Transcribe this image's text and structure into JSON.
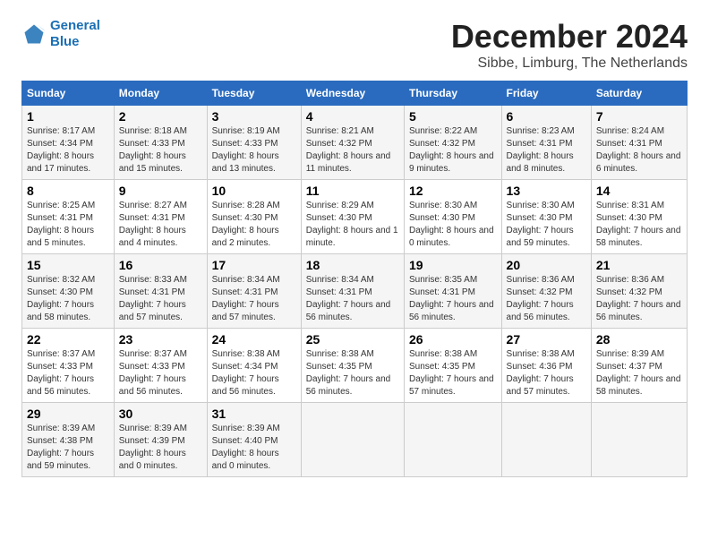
{
  "logo": {
    "line1": "General",
    "line2": "Blue"
  },
  "title": "December 2024",
  "subtitle": "Sibbe, Limburg, The Netherlands",
  "weekdays": [
    "Sunday",
    "Monday",
    "Tuesday",
    "Wednesday",
    "Thursday",
    "Friday",
    "Saturday"
  ],
  "weeks": [
    [
      {
        "day": "1",
        "sunrise": "8:17 AM",
        "sunset": "4:34 PM",
        "daylight": "8 hours and 17 minutes."
      },
      {
        "day": "2",
        "sunrise": "8:18 AM",
        "sunset": "4:33 PM",
        "daylight": "8 hours and 15 minutes."
      },
      {
        "day": "3",
        "sunrise": "8:19 AM",
        "sunset": "4:33 PM",
        "daylight": "8 hours and 13 minutes."
      },
      {
        "day": "4",
        "sunrise": "8:21 AM",
        "sunset": "4:32 PM",
        "daylight": "8 hours and 11 minutes."
      },
      {
        "day": "5",
        "sunrise": "8:22 AM",
        "sunset": "4:32 PM",
        "daylight": "8 hours and 9 minutes."
      },
      {
        "day": "6",
        "sunrise": "8:23 AM",
        "sunset": "4:31 PM",
        "daylight": "8 hours and 8 minutes."
      },
      {
        "day": "7",
        "sunrise": "8:24 AM",
        "sunset": "4:31 PM",
        "daylight": "8 hours and 6 minutes."
      }
    ],
    [
      {
        "day": "8",
        "sunrise": "8:25 AM",
        "sunset": "4:31 PM",
        "daylight": "8 hours and 5 minutes."
      },
      {
        "day": "9",
        "sunrise": "8:27 AM",
        "sunset": "4:31 PM",
        "daylight": "8 hours and 4 minutes."
      },
      {
        "day": "10",
        "sunrise": "8:28 AM",
        "sunset": "4:30 PM",
        "daylight": "8 hours and 2 minutes."
      },
      {
        "day": "11",
        "sunrise": "8:29 AM",
        "sunset": "4:30 PM",
        "daylight": "8 hours and 1 minute."
      },
      {
        "day": "12",
        "sunrise": "8:30 AM",
        "sunset": "4:30 PM",
        "daylight": "8 hours and 0 minutes."
      },
      {
        "day": "13",
        "sunrise": "8:30 AM",
        "sunset": "4:30 PM",
        "daylight": "7 hours and 59 minutes."
      },
      {
        "day": "14",
        "sunrise": "8:31 AM",
        "sunset": "4:30 PM",
        "daylight": "7 hours and 58 minutes."
      }
    ],
    [
      {
        "day": "15",
        "sunrise": "8:32 AM",
        "sunset": "4:30 PM",
        "daylight": "7 hours and 58 minutes."
      },
      {
        "day": "16",
        "sunrise": "8:33 AM",
        "sunset": "4:31 PM",
        "daylight": "7 hours and 57 minutes."
      },
      {
        "day": "17",
        "sunrise": "8:34 AM",
        "sunset": "4:31 PM",
        "daylight": "7 hours and 57 minutes."
      },
      {
        "day": "18",
        "sunrise": "8:34 AM",
        "sunset": "4:31 PM",
        "daylight": "7 hours and 56 minutes."
      },
      {
        "day": "19",
        "sunrise": "8:35 AM",
        "sunset": "4:31 PM",
        "daylight": "7 hours and 56 minutes."
      },
      {
        "day": "20",
        "sunrise": "8:36 AM",
        "sunset": "4:32 PM",
        "daylight": "7 hours and 56 minutes."
      },
      {
        "day": "21",
        "sunrise": "8:36 AM",
        "sunset": "4:32 PM",
        "daylight": "7 hours and 56 minutes."
      }
    ],
    [
      {
        "day": "22",
        "sunrise": "8:37 AM",
        "sunset": "4:33 PM",
        "daylight": "7 hours and 56 minutes."
      },
      {
        "day": "23",
        "sunrise": "8:37 AM",
        "sunset": "4:33 PM",
        "daylight": "7 hours and 56 minutes."
      },
      {
        "day": "24",
        "sunrise": "8:38 AM",
        "sunset": "4:34 PM",
        "daylight": "7 hours and 56 minutes."
      },
      {
        "day": "25",
        "sunrise": "8:38 AM",
        "sunset": "4:35 PM",
        "daylight": "7 hours and 56 minutes."
      },
      {
        "day": "26",
        "sunrise": "8:38 AM",
        "sunset": "4:35 PM",
        "daylight": "7 hours and 57 minutes."
      },
      {
        "day": "27",
        "sunrise": "8:38 AM",
        "sunset": "4:36 PM",
        "daylight": "7 hours and 57 minutes."
      },
      {
        "day": "28",
        "sunrise": "8:39 AM",
        "sunset": "4:37 PM",
        "daylight": "7 hours and 58 minutes."
      }
    ],
    [
      {
        "day": "29",
        "sunrise": "8:39 AM",
        "sunset": "4:38 PM",
        "daylight": "7 hours and 59 minutes."
      },
      {
        "day": "30",
        "sunrise": "8:39 AM",
        "sunset": "4:39 PM",
        "daylight": "8 hours and 0 minutes."
      },
      {
        "day": "31",
        "sunrise": "8:39 AM",
        "sunset": "4:40 PM",
        "daylight": "8 hours and 0 minutes."
      },
      null,
      null,
      null,
      null
    ]
  ]
}
